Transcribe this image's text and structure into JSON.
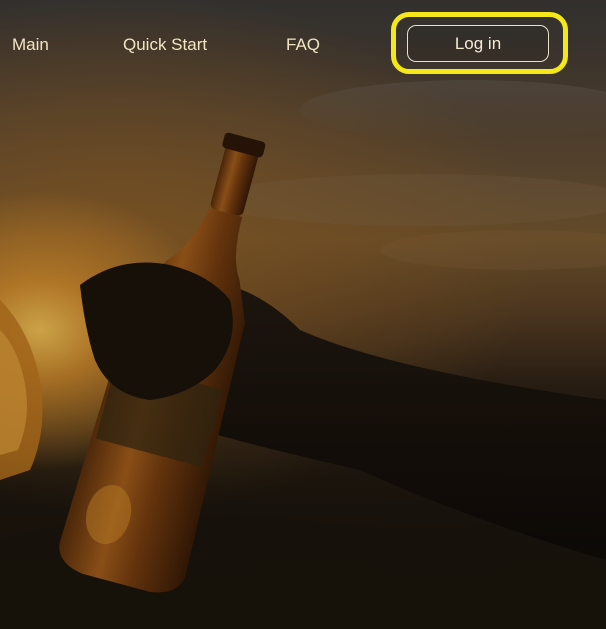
{
  "nav": {
    "items": [
      {
        "label": "Main"
      },
      {
        "label": "Quick Start"
      },
      {
        "label": "FAQ"
      }
    ],
    "login_label": "Log in"
  },
  "colors": {
    "highlight": "#f4e71a",
    "nav_text": "#f1e6c4"
  }
}
